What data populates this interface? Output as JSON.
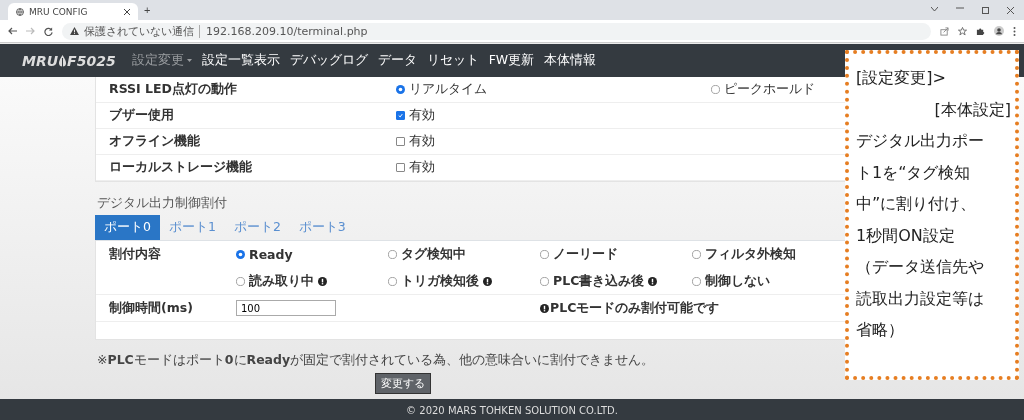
{
  "browser": {
    "tab_title": "MRU CONFIG",
    "new_tab": "+",
    "security": "保護されていない通信",
    "url": "192.168.209.10/terminal.php"
  },
  "navbar": {
    "brand_left": "MRU",
    "brand_right": "F5025",
    "items": [
      {
        "label": "設定変更",
        "dropdown": true,
        "selected": true
      },
      {
        "label": "設定一覧表示",
        "dropdown": false,
        "selected": false
      },
      {
        "label": "デバッグログ",
        "dropdown": false,
        "selected": false
      },
      {
        "label": "データ",
        "dropdown": false,
        "selected": false
      },
      {
        "label": "リセット",
        "dropdown": false,
        "selected": false
      },
      {
        "label": "FW更新",
        "dropdown": false,
        "selected": false
      },
      {
        "label": "本体情報",
        "dropdown": false,
        "selected": false
      }
    ]
  },
  "settings": [
    {
      "label": "RSSI LED点灯の動作",
      "kind": "radio",
      "options": [
        {
          "label": "リアルタイム",
          "selected": true
        },
        {
          "label": "ピークホールド",
          "selected": false
        }
      ]
    },
    {
      "label": "ブザー使用",
      "kind": "checkbox",
      "option": "有効",
      "checked": true
    },
    {
      "label": "オフライン機能",
      "kind": "checkbox",
      "option": "有効",
      "checked": false
    },
    {
      "label": "ローカルストレージ機能",
      "kind": "checkbox",
      "option": "有効",
      "checked": false
    }
  ],
  "section_title": "デジタル出力制御割付",
  "ports": [
    {
      "label": "ポート0",
      "selected": true
    },
    {
      "label": "ポート1",
      "selected": false
    },
    {
      "label": "ポート2",
      "selected": false
    },
    {
      "label": "ポート3",
      "selected": false
    }
  ],
  "assign": {
    "label": "割付内容",
    "options": [
      {
        "label": "Ready",
        "selected": true,
        "info": false
      },
      {
        "label": "タグ検知中",
        "selected": false,
        "info": false
      },
      {
        "label": "ノーリード",
        "selected": false,
        "info": false
      },
      {
        "label": "フィルタ外検知",
        "selected": false,
        "info": false
      },
      {
        "label": "読み取り中",
        "selected": false,
        "info": true
      },
      {
        "label": "トリガ検知後",
        "selected": false,
        "info": true
      },
      {
        "label": "PLC書き込み後",
        "selected": false,
        "info": true
      },
      {
        "label": "制御しない",
        "selected": false,
        "info": false
      }
    ]
  },
  "time": {
    "label": "制御時間(ms)",
    "value": "100",
    "note": "PLCモードのみ割付可能です"
  },
  "footnote": "※**PLC**モードはポート**0**に**Ready**が固定で割付されている為、他の意味合いに割付できません。",
  "submit": "変更する",
  "footer": "© 2020 MARS TOHKEN SOLUTION CO.LTD.",
  "annotation": {
    "lines": [
      "[設定変更]>",
      "[本体設定]",
      "デジタル出力ポー",
      "ト1を“タグ検知",
      "中”に割り付け、",
      "1秒間ON設定",
      "（データ送信先や",
      "読取出力設定等は",
      "省略）"
    ]
  }
}
